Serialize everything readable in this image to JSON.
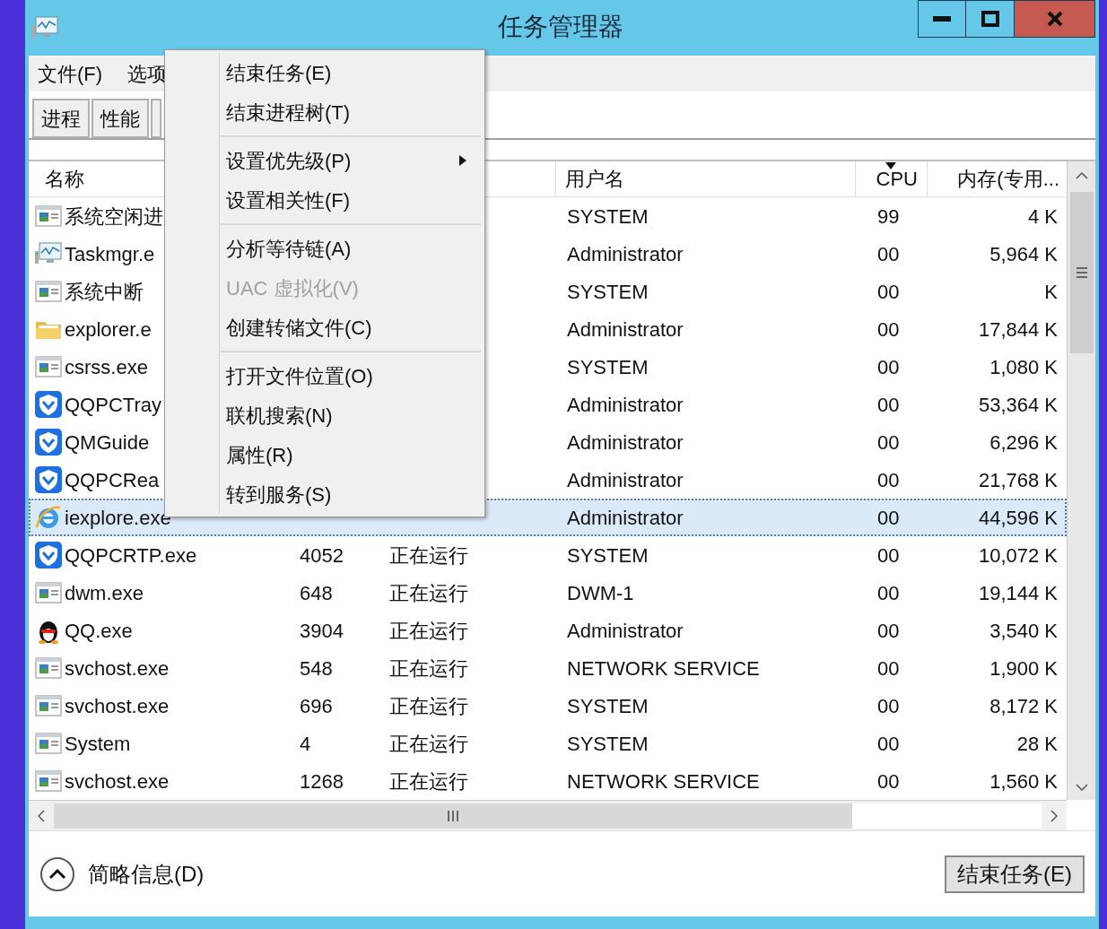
{
  "window": {
    "title": "任务管理器"
  },
  "menu_bar": [
    "文件(F)",
    "选项"
  ],
  "tabs": [
    "进程",
    "性能"
  ],
  "table": {
    "columns": [
      "名称",
      "用户名",
      "CPU",
      "内存(专用..."
    ],
    "rows": [
      {
        "kind": "app",
        "name": "系统空闲进",
        "user": "SYSTEM",
        "cpu": "99",
        "memory": "4 K",
        "selected": false
      },
      {
        "kind": "monitor",
        "name": "Taskmgr.e",
        "user": "Administrator",
        "cpu": "00",
        "memory": "5,964 K",
        "selected": false
      },
      {
        "kind": "app",
        "name": "系统中断",
        "user": "SYSTEM",
        "cpu": "00",
        "memory": "K",
        "selected": false
      },
      {
        "kind": "folder",
        "name": "explorer.e",
        "user": "Administrator",
        "cpu": "00",
        "memory": "17,844 K",
        "selected": false
      },
      {
        "kind": "app",
        "name": "csrss.exe",
        "user": "SYSTEM",
        "cpu": "00",
        "memory": "1,080 K",
        "selected": false
      },
      {
        "kind": "shield",
        "name": "QQPCTray",
        "user": "Administrator",
        "cpu": "00",
        "memory": "53,364 K",
        "selected": false
      },
      {
        "kind": "shield",
        "name": "QMGuide",
        "user": "Administrator",
        "cpu": "00",
        "memory": "6,296 K",
        "selected": false
      },
      {
        "kind": "shield",
        "name": "QQPCRea",
        "user": "Administrator",
        "cpu": "00",
        "memory": "21,768 K",
        "selected": false
      },
      {
        "kind": "browser",
        "name": "iexplore.exe",
        "user": "Administrator",
        "cpu": "00",
        "memory": "44,596 K",
        "selected": true
      },
      {
        "kind": "shield",
        "name": "QQPCRTP.exe",
        "pid": "4052",
        "status": "正在运行",
        "user": "SYSTEM",
        "cpu": "00",
        "memory": "10,072 K",
        "selected": false
      },
      {
        "kind": "app",
        "name": "dwm.exe",
        "pid": "648",
        "status": "正在运行",
        "user": "DWM-1",
        "cpu": "00",
        "memory": "19,144 K",
        "selected": false
      },
      {
        "kind": "penguin",
        "name": "QQ.exe",
        "pid": "3904",
        "status": "正在运行",
        "user": "Administrator",
        "cpu": "00",
        "memory": "3,540 K",
        "selected": false
      },
      {
        "kind": "app",
        "name": "svchost.exe",
        "pid": "548",
        "status": "正在运行",
        "user": "NETWORK SERVICE",
        "cpu": "00",
        "memory": "1,900 K",
        "selected": false
      },
      {
        "kind": "app",
        "name": "svchost.exe",
        "pid": "696",
        "status": "正在运行",
        "user": "SYSTEM",
        "cpu": "00",
        "memory": "8,172 K",
        "selected": false
      },
      {
        "kind": "app",
        "name": "System",
        "pid": "4",
        "status": "正在运行",
        "user": "SYSTEM",
        "cpu": "00",
        "memory": "28 K",
        "selected": false
      },
      {
        "kind": "app",
        "name": "svchost.exe",
        "pid": "1268",
        "status": "正在运行",
        "user": "NETWORK SERVICE",
        "cpu": "00",
        "memory": "1,560 K",
        "selected": false
      }
    ]
  },
  "context_menu": [
    {
      "kind": "item",
      "label": "结束任务(E)",
      "disabled": false
    },
    {
      "kind": "item",
      "label": "结束进程树(T)",
      "disabled": false
    },
    {
      "kind": "separator"
    },
    {
      "kind": "submenu",
      "label": "设置优先级(P)",
      "disabled": false
    },
    {
      "kind": "item",
      "label": "设置相关性(F)",
      "disabled": false
    },
    {
      "kind": "separator"
    },
    {
      "kind": "item",
      "label": "分析等待链(A)",
      "disabled": false
    },
    {
      "kind": "item",
      "label": "UAC 虚拟化(V)",
      "disabled": true
    },
    {
      "kind": "item",
      "label": "创建转储文件(C)",
      "disabled": false
    },
    {
      "kind": "separator"
    },
    {
      "kind": "item",
      "label": "打开文件位置(O)",
      "disabled": false
    },
    {
      "kind": "item",
      "label": "联机搜索(N)",
      "disabled": false
    },
    {
      "kind": "item",
      "label": "属性(R)",
      "disabled": false
    },
    {
      "kind": "item",
      "label": "转到服务(S)",
      "disabled": false
    }
  ],
  "footer": {
    "details_link": "简略信息(D)",
    "end_task_button": "结束任务(E)"
  }
}
